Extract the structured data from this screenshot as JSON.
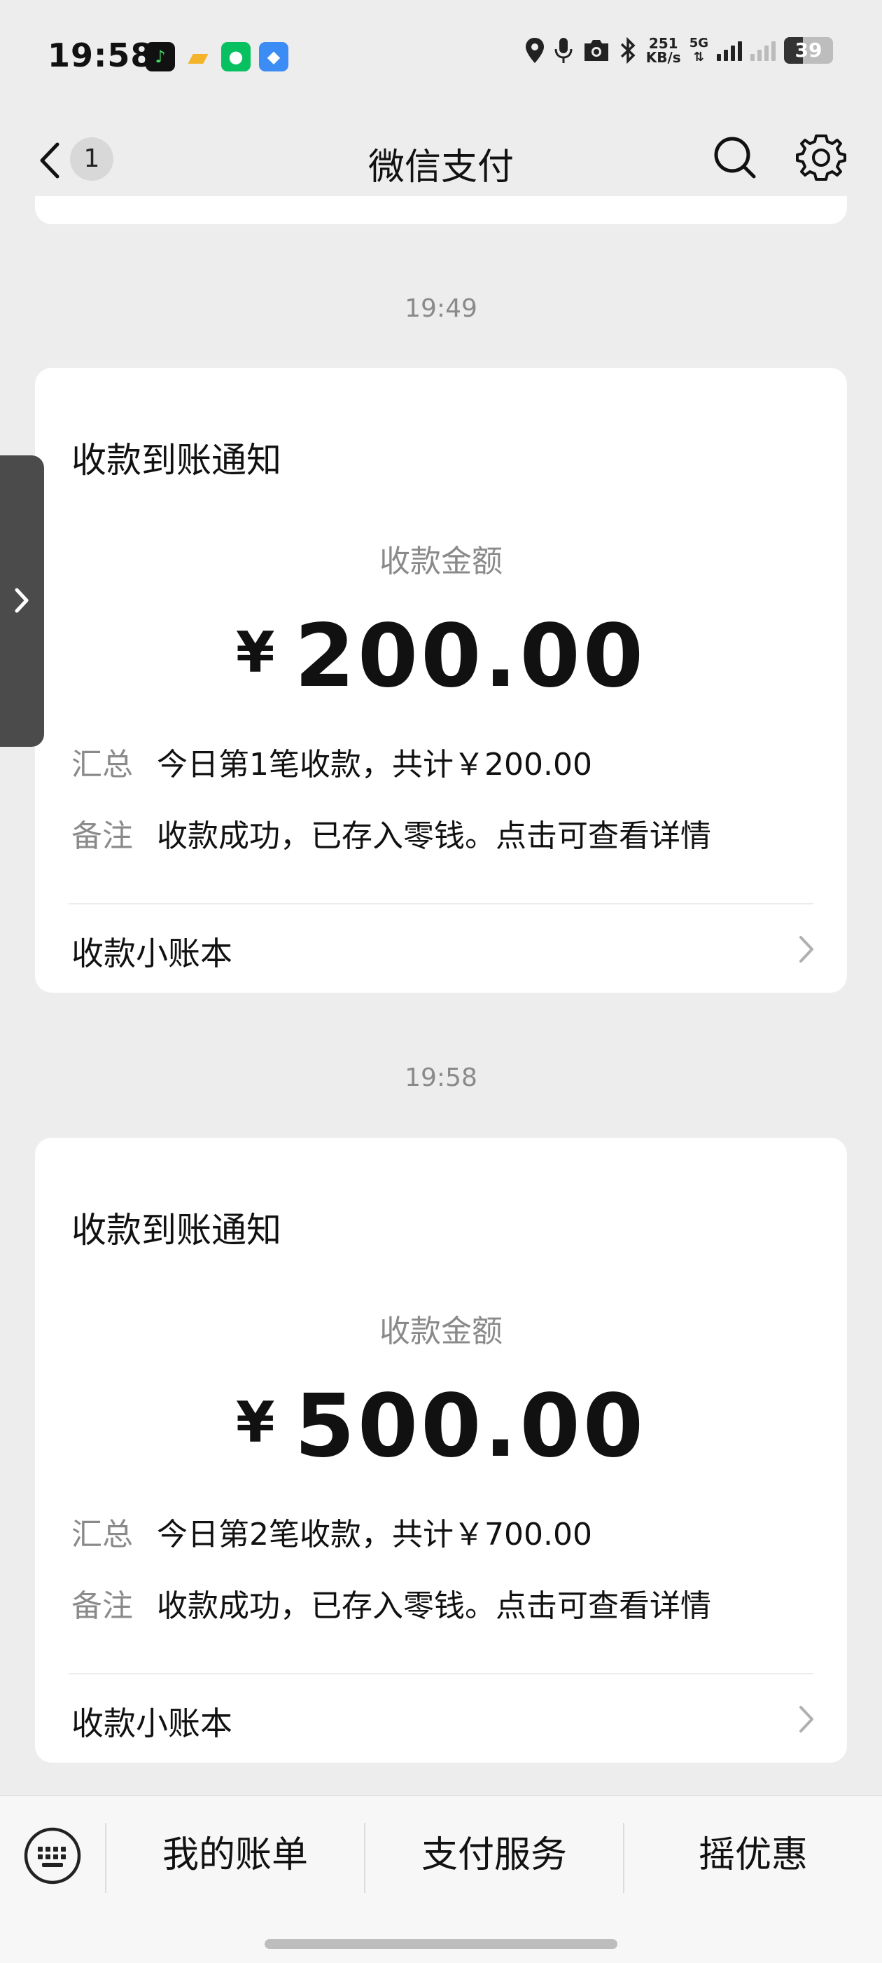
{
  "status_bar": {
    "time": "19:58",
    "speed_value": "251",
    "speed_unit": "KB/s",
    "network": "5G",
    "battery": "39",
    "battery_level": 0.39
  },
  "nav": {
    "title": "微信支付",
    "unread_count": "1"
  },
  "messages": [
    {
      "timestamp": "19:49",
      "title": "收款到账通知",
      "amount_label": "收款金额",
      "currency": "¥",
      "amount": "200.00",
      "summary_label": "汇总",
      "summary_value": "今日第1笔收款，共计￥200.00",
      "note_label": "备注",
      "note_value": "收款成功，已存入零钱。点击可查看详情",
      "ledger_label": "收款小账本"
    },
    {
      "timestamp": "19:58",
      "title": "收款到账通知",
      "amount_label": "收款金额",
      "currency": "¥",
      "amount": "500.00",
      "summary_label": "汇总",
      "summary_value": "今日第2笔收款，共计￥700.00",
      "note_label": "备注",
      "note_value": "收款成功，已存入零钱。点击可查看详情",
      "ledger_label": "收款小账本"
    }
  ],
  "bottom_menu": {
    "items": [
      "我的账单",
      "支付服务",
      "摇优惠"
    ]
  },
  "colors": {
    "background": "#ededed",
    "card": "#ffffff",
    "muted_text": "#8a8a8a",
    "wechat_green": "#07c160"
  },
  "icons": [
    "back-arrow-icon",
    "search-icon",
    "gear-icon",
    "chevron-right-icon",
    "keyboard-icon"
  ]
}
